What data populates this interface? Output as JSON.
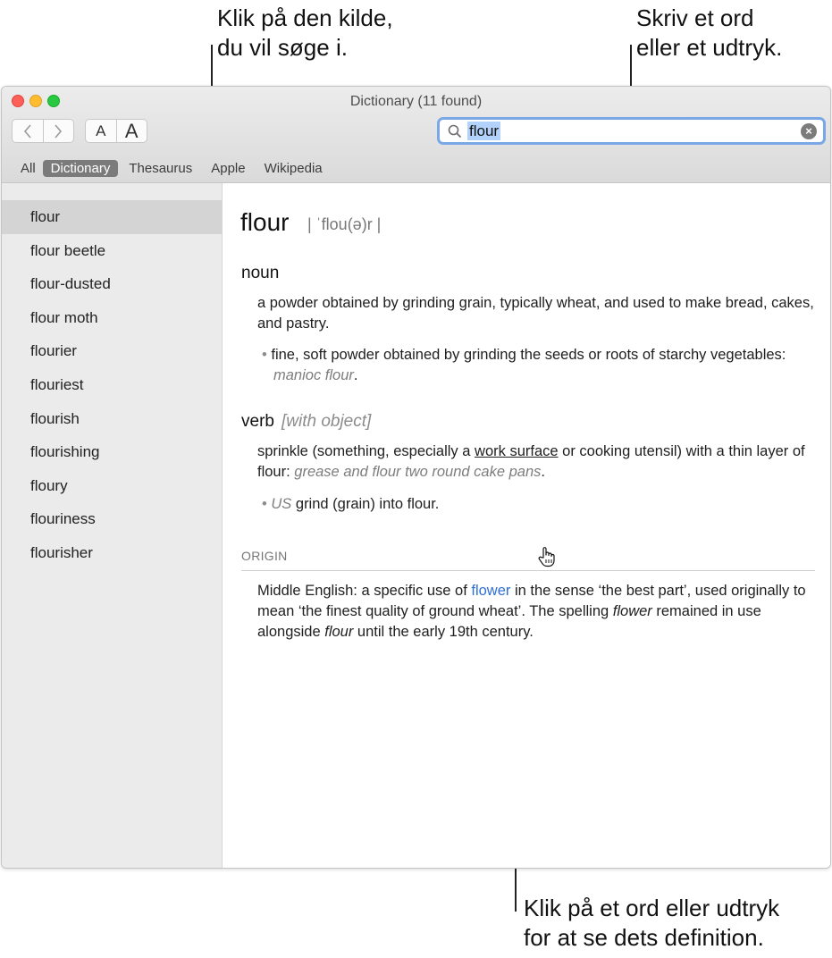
{
  "callouts": {
    "source": [
      "Klik på den kilde,",
      "du vil søge i."
    ],
    "search": [
      "Skriv et ord",
      "eller et udtryk."
    ],
    "word": [
      "Klik på et ord eller udtryk",
      "for at se dets definition."
    ]
  },
  "window": {
    "title": "Dictionary (11 found)",
    "font_small": "A",
    "font_large": "A"
  },
  "search": {
    "value": "flour",
    "icon": "magnifier-icon",
    "clear_icon": "clear-icon"
  },
  "scope_tabs": [
    {
      "label": "All",
      "active": false
    },
    {
      "label": "Dictionary",
      "active": true
    },
    {
      "label": "Thesaurus",
      "active": false
    },
    {
      "label": "Apple",
      "active": false
    },
    {
      "label": "Wikipedia",
      "active": false
    }
  ],
  "results": [
    "flour",
    "flour beetle",
    "flour-dusted",
    "flour moth",
    "flourier",
    "flouriest",
    "flourish",
    "flourishing",
    "floury",
    "flouriness",
    "flourisher"
  ],
  "entry": {
    "headword": "flour",
    "pronunciation": "| ˈflou(ə)r |",
    "noun": {
      "label": "noun",
      "def1": "a powder obtained by grinding grain, typically wheat, and used to make bread, cakes, and pastry.",
      "def2": "fine, soft powder obtained by grinding the seeds or roots of starchy vegetables:",
      "def2_example": "manioc flour",
      "period": "."
    },
    "verb": {
      "label": "verb",
      "grammar": "[with object]",
      "def1_a": "sprinkle (something, especially a ",
      "def1_link": "work surface",
      "def1_b": " or cooking utensil) with a thin layer of flour: ",
      "def1_example": "grease and flour two round cake pans",
      "period": ".",
      "def2_region": "US",
      "def2": "grind (grain) into flour."
    },
    "origin": {
      "heading": "ORIGIN",
      "text_a": "Middle English: a specific use of ",
      "link": "flower",
      "text_b": " in the sense ‘the best part’, used originally to mean ‘the finest quality of ground wheat’. The spelling ",
      "em1": "flower",
      "text_c": " remained in use alongside ",
      "em2": "flour",
      "text_d": " until the early 19th century."
    }
  }
}
